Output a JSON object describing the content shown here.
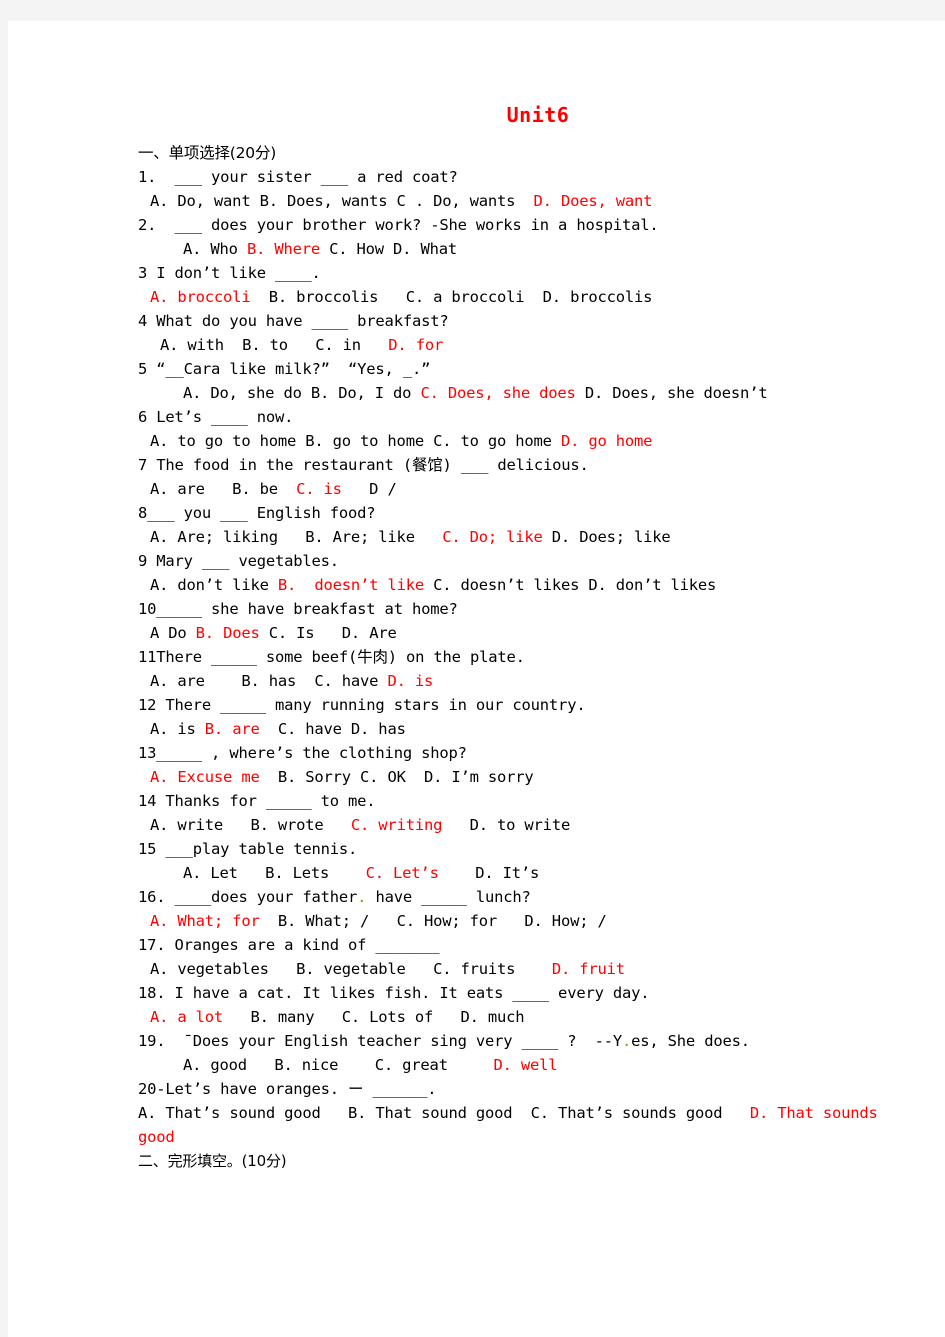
{
  "document": {
    "title": "Unit6",
    "title_color": "#ff0000",
    "answer_color": "#ff0000",
    "page_background": "#ffffff",
    "canvas_background": "#f4f4f4"
  },
  "sections": [
    {
      "heading": "一、单项选择(20分)",
      "heading_indent": "ind0"
    }
  ],
  "lines": [
    {
      "indent": "ind0",
      "parts": [
        {
          "t": "1.  ___ your sister ___ a red coat?",
          "c": "black"
        }
      ]
    },
    {
      "indent": "ind1",
      "parts": [
        {
          "t": "A. Do, want B. Does, wants C . Do, wants  ",
          "c": "black"
        },
        {
          "t": "D. Does, want",
          "c": "red"
        }
      ]
    },
    {
      "indent": "ind0",
      "parts": [
        {
          "t": "2.  ___ does your brother work? -She works in a hospital.",
          "c": "black"
        }
      ]
    },
    {
      "indent": "ind3",
      "parts": [
        {
          "t": "A. Who ",
          "c": "black"
        },
        {
          "t": "B. Where",
          "c": "red"
        },
        {
          "t": " C. How D. What",
          "c": "black"
        }
      ]
    },
    {
      "indent": "ind0",
      "parts": [
        {
          "t": "3 I don’t like ____.",
          "c": "black"
        }
      ]
    },
    {
      "indent": "ind1",
      "parts": [
        {
          "t": "A. broccoli",
          "c": "red"
        },
        {
          "t": "  B. broccolis   C. a broccoli  D. broccolis",
          "c": "black"
        }
      ]
    },
    {
      "indent": "ind0",
      "parts": [
        {
          "t": "4 What do you have ____ breakfast?",
          "c": "black"
        }
      ]
    },
    {
      "indent": "ind2",
      "parts": [
        {
          "t": "A. with  B. to   C. in   ",
          "c": "black"
        },
        {
          "t": "D. for",
          "c": "red"
        }
      ]
    },
    {
      "indent": "ind0",
      "parts": [
        {
          "t": "5 “__Cara like milk?”  “Yes, _.”",
          "c": "black"
        }
      ]
    },
    {
      "indent": "ind3",
      "parts": [
        {
          "t": "A. Do, she do B. Do, I do ",
          "c": "black"
        },
        {
          "t": "C. Does, she does",
          "c": "red"
        },
        {
          "t": " D. Does, she doesn’t",
          "c": "black"
        }
      ]
    },
    {
      "indent": "ind0",
      "parts": [
        {
          "t": "6 Let’s ____ now.",
          "c": "black"
        }
      ]
    },
    {
      "indent": "ind1",
      "parts": [
        {
          "t": "A. to go to home B. go to home C. to go home ",
          "c": "black"
        },
        {
          "t": "D. go home",
          "c": "red"
        }
      ]
    },
    {
      "indent": "ind0",
      "parts": [
        {
          "t": "7 The food in the restaurant (餐馆) ___ delicious.",
          "c": "black"
        }
      ]
    },
    {
      "indent": "ind1",
      "parts": [
        {
          "t": "A. are   B. be  ",
          "c": "black"
        },
        {
          "t": "C. is",
          "c": "red"
        },
        {
          "t": "   D /",
          "c": "black"
        }
      ]
    },
    {
      "indent": "ind0",
      "parts": [
        {
          "t": "8___ you ___ English food?",
          "c": "black"
        }
      ]
    },
    {
      "indent": "ind1",
      "parts": [
        {
          "t": "A. Are; liking   B. Are; like   ",
          "c": "black"
        },
        {
          "t": "C. Do; like",
          "c": "red"
        },
        {
          "t": " D. Does; like",
          "c": "black"
        }
      ]
    },
    {
      "indent": "ind0",
      "parts": [
        {
          "t": "9 Mary ___ vegetables.",
          "c": "black"
        }
      ]
    },
    {
      "indent": "ind1",
      "parts": [
        {
          "t": "A. don’t like ",
          "c": "black"
        },
        {
          "t": "B.  doesn’t like",
          "c": "red"
        },
        {
          "t": " C. doesn’t likes D. don’t likes",
          "c": "black"
        }
      ]
    },
    {
      "indent": "ind0",
      "parts": [
        {
          "t": "10_____ she have breakfast at home?",
          "c": "black"
        }
      ]
    },
    {
      "indent": "ind1",
      "parts": [
        {
          "t": "A Do ",
          "c": "black"
        },
        {
          "t": "B. Does",
          "c": "red"
        },
        {
          "t": " C. Is   D. Are",
          "c": "black"
        }
      ]
    },
    {
      "indent": "ind0",
      "parts": [
        {
          "t": "11There _____ some beef(牛肉) on the plate.",
          "c": "black"
        }
      ]
    },
    {
      "indent": "ind1",
      "parts": [
        {
          "t": "A. are    B. has  C. have ",
          "c": "black"
        },
        {
          "t": "D. is",
          "c": "red"
        }
      ]
    },
    {
      "indent": "ind0",
      "parts": [
        {
          "t": "12 There _____ many running stars in our country.",
          "c": "black"
        }
      ]
    },
    {
      "indent": "ind1",
      "parts": [
        {
          "t": "A. is ",
          "c": "black"
        },
        {
          "t": "B. are",
          "c": "red"
        },
        {
          "t": "  C. have D. has",
          "c": "black"
        }
      ]
    },
    {
      "indent": "ind0",
      "parts": [
        {
          "t": "13_____ , where’s the clothing shop?",
          "c": "black"
        }
      ]
    },
    {
      "indent": "ind1",
      "parts": [
        {
          "t": "A. Excuse me",
          "c": "red"
        },
        {
          "t": "  B. Sorry C. OK  D. I’m sorry",
          "c": "black"
        }
      ]
    },
    {
      "indent": "ind0",
      "parts": [
        {
          "t": "14 Thanks for _____ to me.",
          "c": "black"
        }
      ]
    },
    {
      "indent": "ind1",
      "parts": [
        {
          "t": "A. write   B. wrote   ",
          "c": "black"
        },
        {
          "t": "C. writing",
          "c": "red"
        },
        {
          "t": "   D. to write",
          "c": "black"
        }
      ]
    },
    {
      "indent": "ind0",
      "parts": [
        {
          "t": "15 ___play table tennis.",
          "c": "black"
        }
      ]
    },
    {
      "indent": "ind3",
      "parts": [
        {
          "t": "A. Let   B. Lets    ",
          "c": "black"
        },
        {
          "t": "C. Let’s",
          "c": "red"
        },
        {
          "t": "    D. It’s",
          "c": "black"
        }
      ]
    },
    {
      "indent": "ind0",
      "parts": [
        {
          "t": "16. ____does your father",
          "c": "black"
        },
        {
          "t": ".",
          "c": "olive"
        },
        {
          "t": " have _____ lunch?",
          "c": "black"
        }
      ]
    },
    {
      "indent": "ind1",
      "parts": [
        {
          "t": "A. What; for",
          "c": "red"
        },
        {
          "t": "  B. What; /   C. How; for   D. How; /",
          "c": "black"
        }
      ]
    },
    {
      "indent": "ind0",
      "parts": [
        {
          "t": "17. Oranges are a kind of _______",
          "c": "black"
        }
      ]
    },
    {
      "indent": "ind1",
      "parts": [
        {
          "t": "A. vegetables   B. vegetable   C. fruits    ",
          "c": "black"
        },
        {
          "t": "D. fruit",
          "c": "red"
        }
      ]
    },
    {
      "indent": "ind0",
      "parts": [
        {
          "t": "18. I have a cat. It likes fish. It eats ____ every day.",
          "c": "black"
        }
      ]
    },
    {
      "indent": "ind1",
      "parts": [
        {
          "t": "A. a lot",
          "c": "red"
        },
        {
          "t": "   B. many   C. Lots of   D. much",
          "c": "black"
        }
      ]
    },
    {
      "indent": "ind0",
      "parts": [
        {
          "t": "19.  ˉDoes your English teacher sing very ____ ?  --Y",
          "c": "black"
        },
        {
          "t": ".",
          "c": "olive"
        },
        {
          "t": "es, She does.",
          "c": "black"
        }
      ]
    },
    {
      "indent": "ind3",
      "parts": [
        {
          "t": "A. good   B. nice    C. great     ",
          "c": "black"
        },
        {
          "t": "D. well",
          "c": "red"
        }
      ]
    },
    {
      "indent": "ind0",
      "parts": [
        {
          "t": "20-Let’s have oranges. ー ______.",
          "c": "black"
        }
      ]
    },
    {
      "indent": "ind0",
      "parts": [
        {
          "t": "A. That’s sound good   B. That sound good  C. That’s sounds good   ",
          "c": "black"
        },
        {
          "t": "D. That sounds",
          "c": "red"
        }
      ]
    },
    {
      "indent": "ind0",
      "parts": [
        {
          "t": "good",
          "c": "red"
        }
      ]
    },
    {
      "indent": "ind0",
      "cn": true,
      "parts": [
        {
          "t": "二、完形填空。(10分)",
          "c": "black"
        }
      ]
    }
  ]
}
